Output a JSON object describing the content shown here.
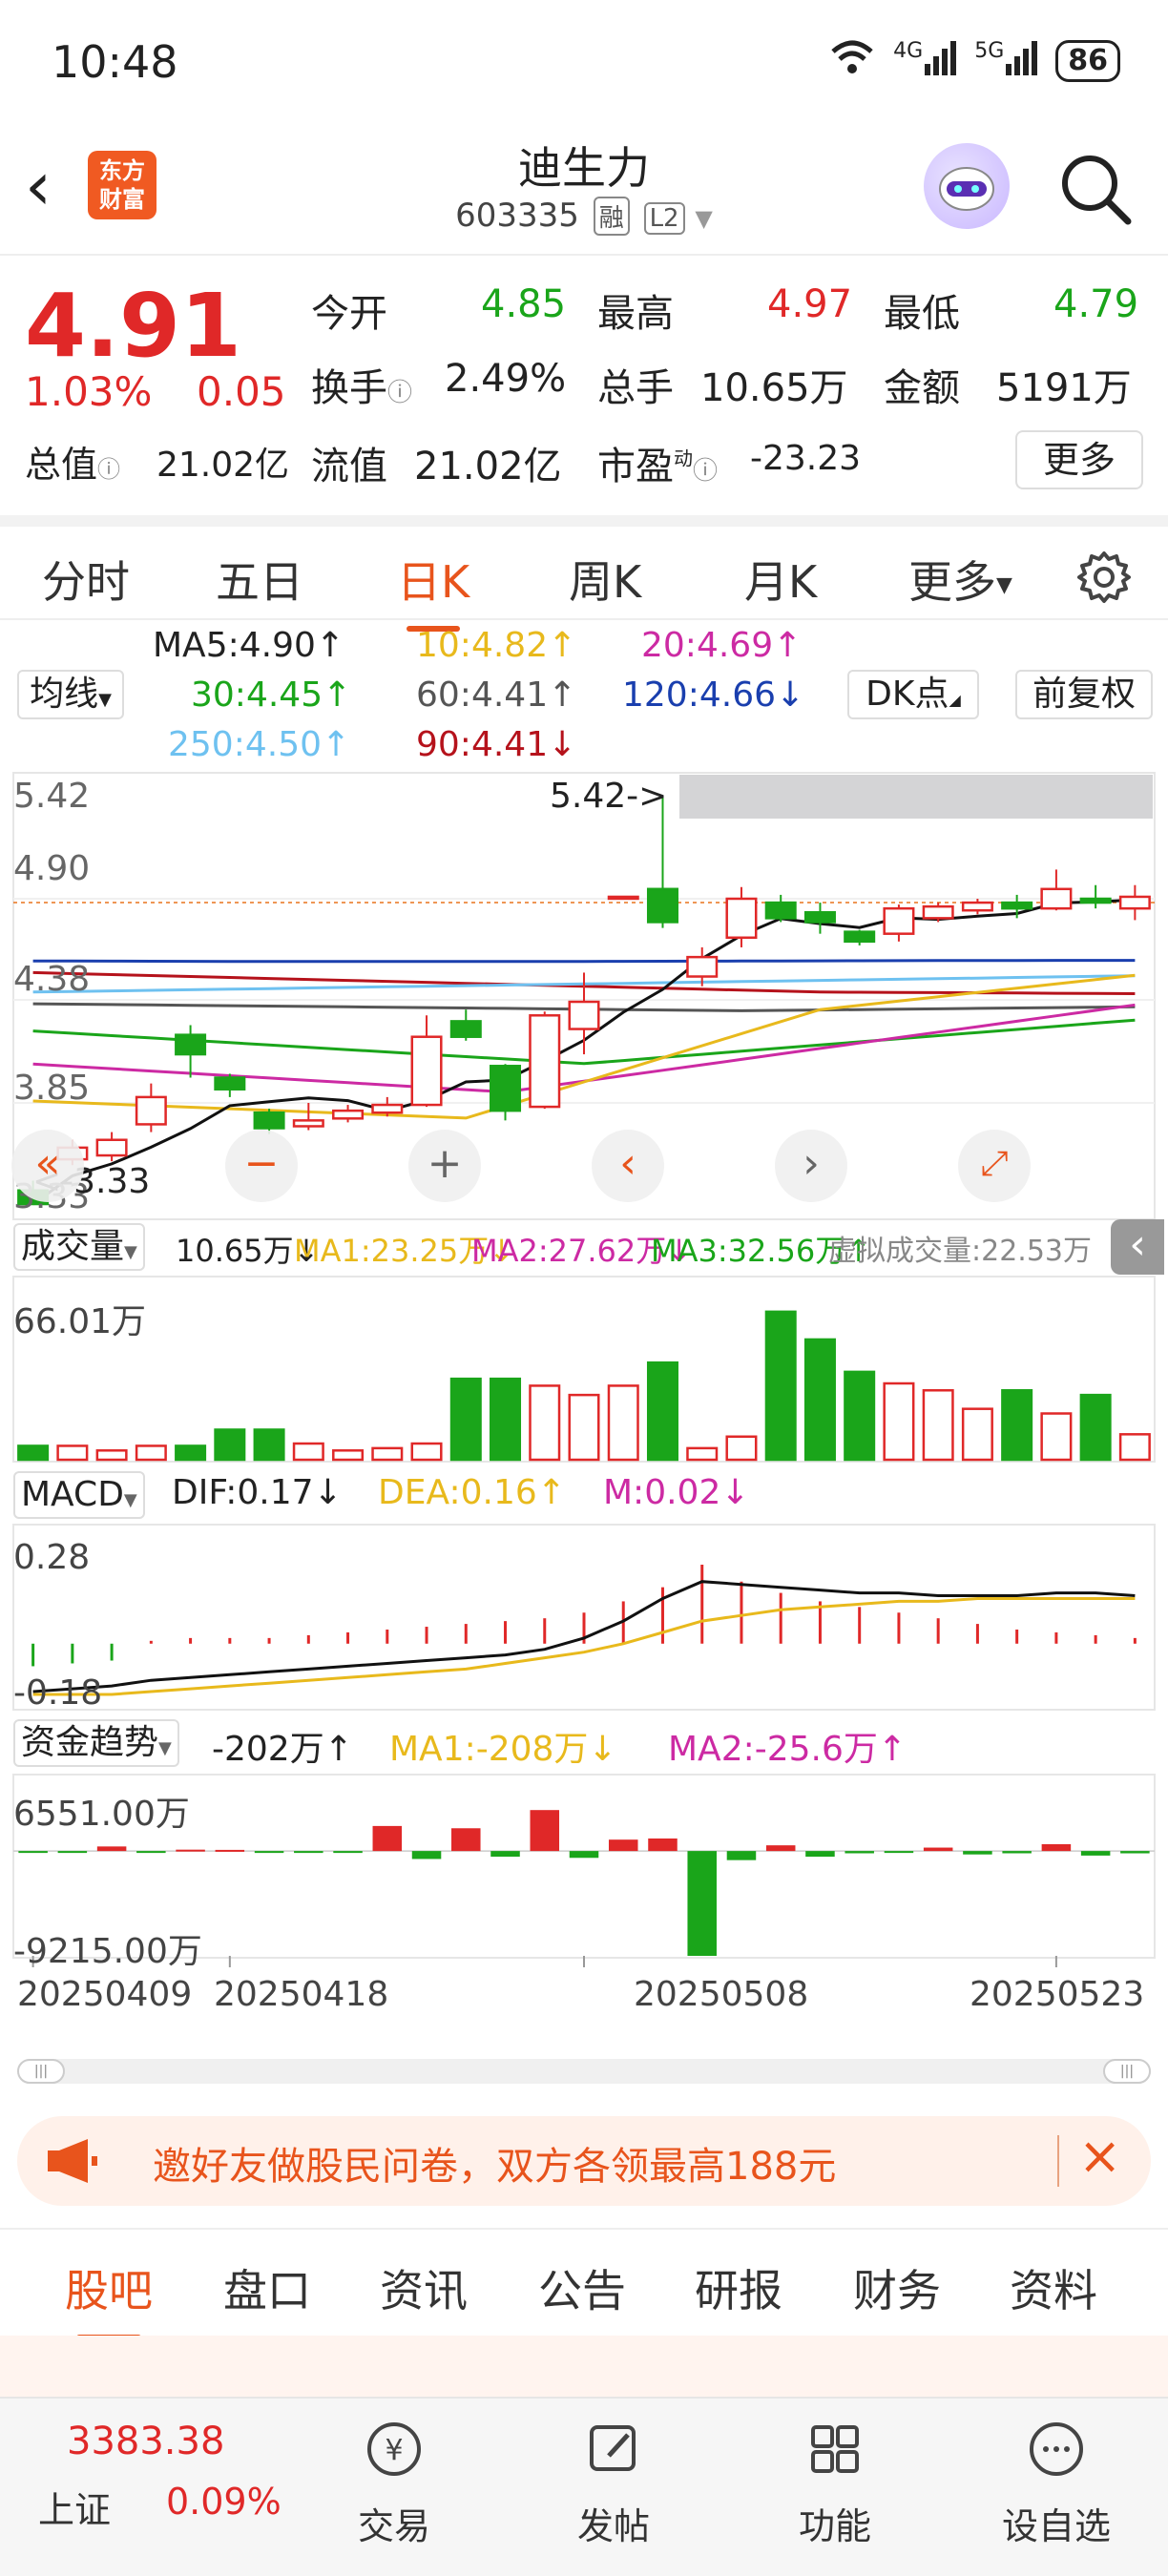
{
  "status": {
    "time": "10:48",
    "net1": "4G",
    "net2": "5G",
    "battery": "86"
  },
  "header": {
    "title": "迪生力",
    "code": "603335",
    "tag1": "融",
    "tag2": "L2",
    "logo_line1": "东方",
    "logo_line2": "财富"
  },
  "quote": {
    "price": "4.91",
    "pct": "1.03%",
    "change": "0.05",
    "open_label": "今开",
    "open": "4.85",
    "high_label": "最高",
    "high": "4.97",
    "low_label": "最低",
    "low": "4.79",
    "turnover_label": "换手",
    "turnover": "2.49%",
    "volume_label": "总手",
    "volume": "10.65万",
    "amount_label": "金额",
    "amount": "5191万",
    "mcap_label": "总值",
    "mcap": "21.02亿",
    "float_label": "流值",
    "float": "21.02亿",
    "pe_label": "市盈",
    "pe_sup": "动",
    "pe": "-23.23",
    "more": "更多"
  },
  "tabs": [
    "分时",
    "五日",
    "日K",
    "周K",
    "月K",
    "更多"
  ],
  "ma": {
    "selector": "均线",
    "ma5": "MA5:4.90↑",
    "ma10": "10:4.82↑",
    "ma20": "20:4.69↑",
    "ma30": "30:4.45↑",
    "ma60": "60:4.41↑",
    "ma120": "120:4.66↓",
    "ma250": "250:4.50↑",
    "ma90": "90:4.41↓",
    "dk": "DK点",
    "adj": "前复权"
  },
  "kline": {
    "y_top": "5.42",
    "y_490": "4.90",
    "y_438": "4.38",
    "y_385": "3.85",
    "y_bottom": "3.33",
    "high_mark": "5.42->",
    "low_mark": "<-3.33"
  },
  "volume": {
    "selector": "成交量",
    "val": "10.65万↓",
    "ma1": "MA1:23.25万↓",
    "ma2": "MA2:27.62万↓",
    "ma3": "MA3:32.56万↑",
    "virtual": "虚拟成交量:22.53万",
    "ymax": "66.01万"
  },
  "macd": {
    "selector": "MACD",
    "dif": "DIF:0.17↓",
    "dea": "DEA:0.16↑",
    "m": "M:0.02↓",
    "ytop": "0.28",
    "ybottom": "-0.18"
  },
  "fund": {
    "selector": "资金趋势",
    "val": "-202万↑",
    "ma1": "MA1:-208万↓",
    "ma2": "MA2:-25.6万↑",
    "ytop": "6551.00万",
    "ybottom": "-9215.00万"
  },
  "dates": [
    "20250409",
    "20250418",
    "20250508",
    "20250523"
  ],
  "promo": {
    "text": "邀好友做股民问卷，双方各领最高188元"
  },
  "bottom_tabs": [
    "股吧",
    "盘口",
    "资讯",
    "公告",
    "研报",
    "财务",
    "资料"
  ],
  "footer": {
    "index_value": "3383.38",
    "index_name": "上证",
    "index_pct": "0.09%",
    "trade": "交易",
    "post": "发帖",
    "func": "功能",
    "watch": "设自选"
  },
  "colors": {
    "up": "#e02828",
    "down": "#1aa51a",
    "accent": "#e8541c"
  },
  "chart_data": {
    "type": "candlestick",
    "candles": [
      {
        "o": 3.4,
        "c": 3.33,
        "h": 3.45,
        "l": 3.33
      },
      {
        "o": 3.56,
        "c": 3.62,
        "h": 3.66,
        "l": 3.53
      },
      {
        "o": 3.58,
        "c": 3.66,
        "h": 3.7,
        "l": 3.55
      },
      {
        "o": 3.74,
        "c": 3.88,
        "h": 3.95,
        "l": 3.7
      },
      {
        "o": 4.2,
        "c": 4.1,
        "h": 4.25,
        "l": 3.98
      },
      {
        "o": 3.98,
        "c": 3.92,
        "h": 4.0,
        "l": 3.88
      },
      {
        "o": 3.8,
        "c": 3.72,
        "h": 3.82,
        "l": 3.69
      },
      {
        "o": 3.73,
        "c": 3.76,
        "h": 3.85,
        "l": 3.71
      },
      {
        "o": 3.77,
        "c": 3.81,
        "h": 3.84,
        "l": 3.75
      },
      {
        "o": 3.8,
        "c": 3.84,
        "h": 3.88,
        "l": 3.78
      },
      {
        "o": 3.84,
        "c": 4.19,
        "h": 4.3,
        "l": 3.83
      },
      {
        "o": 4.27,
        "c": 4.19,
        "h": 4.33,
        "l": 4.17
      },
      {
        "o": 4.04,
        "c": 3.81,
        "h": 4.05,
        "l": 3.76
      },
      {
        "o": 3.83,
        "c": 4.3,
        "h": 4.32,
        "l": 3.82
      },
      {
        "o": 4.23,
        "c": 4.37,
        "h": 4.52,
        "l": 4.1
      },
      {
        "o": 4.91,
        "c": 4.91,
        "h": 4.91,
        "l": 4.91
      },
      {
        "o": 4.95,
        "c": 4.78,
        "h": 5.42,
        "l": 4.75
      },
      {
        "o": 4.5,
        "c": 4.6,
        "h": 4.65,
        "l": 4.45
      },
      {
        "o": 4.7,
        "c": 4.9,
        "h": 4.96,
        "l": 4.65
      },
      {
        "o": 4.88,
        "c": 4.8,
        "h": 4.92,
        "l": 4.78
      },
      {
        "o": 4.83,
        "c": 4.78,
        "h": 4.88,
        "l": 4.72
      },
      {
        "o": 4.73,
        "c": 4.68,
        "h": 4.74,
        "l": 4.66
      },
      {
        "o": 4.72,
        "c": 4.85,
        "h": 4.87,
        "l": 4.68
      },
      {
        "o": 4.8,
        "c": 4.86,
        "h": 4.88,
        "l": 4.78
      },
      {
        "o": 4.84,
        "c": 4.88,
        "h": 4.9,
        "l": 4.82
      },
      {
        "o": 4.88,
        "c": 4.85,
        "h": 4.92,
        "l": 4.8
      },
      {
        "o": 4.85,
        "c": 4.95,
        "h": 5.05,
        "l": 4.84
      },
      {
        "o": 4.9,
        "c": 4.88,
        "h": 4.97,
        "l": 4.85
      },
      {
        "o": 4.85,
        "c": 4.91,
        "h": 4.97,
        "l": 4.79
      }
    ],
    "volume": [
      6,
      6,
      4,
      6,
      6,
      13,
      13,
      7,
      4,
      5,
      7,
      35,
      35,
      32,
      28,
      32,
      42,
      5,
      10,
      64,
      52,
      38,
      33,
      30,
      22,
      30,
      20,
      28,
      11
    ],
    "macd_dif": [
      -0.17,
      -0.16,
      -0.15,
      -0.13,
      -0.12,
      -0.11,
      -0.1,
      -0.09,
      -0.08,
      -0.07,
      -0.06,
      -0.05,
      -0.04,
      -0.02,
      0.02,
      0.08,
      0.16,
      0.22,
      0.21,
      0.2,
      0.19,
      0.18,
      0.18,
      0.17,
      0.17,
      0.17,
      0.18,
      0.18,
      0.17
    ],
    "macd_dea": [
      -0.18,
      -0.18,
      -0.18,
      -0.17,
      -0.16,
      -0.15,
      -0.14,
      -0.13,
      -0.12,
      -0.11,
      -0.1,
      -0.09,
      -0.07,
      -0.05,
      -0.03,
      0.0,
      0.04,
      0.08,
      0.1,
      0.12,
      0.13,
      0.14,
      0.15,
      0.15,
      0.16,
      0.16,
      0.16,
      0.16,
      0.16
    ],
    "macd_m": [
      -0.08,
      -0.07,
      -0.06,
      0.01,
      0.02,
      0.02,
      0.02,
      0.03,
      0.04,
      0.05,
      0.06,
      0.07,
      0.08,
      0.09,
      0.11,
      0.15,
      0.2,
      0.28,
      0.22,
      0.18,
      0.15,
      0.13,
      0.11,
      0.09,
      0.07,
      0.05,
      0.04,
      0.03,
      0.02
    ],
    "fund": [
      -100,
      -150,
      400,
      -80,
      120,
      100,
      -60,
      -40,
      -20,
      2200,
      -700,
      2000,
      -500,
      3600,
      -600,
      1000,
      1100,
      -9215,
      -800,
      500,
      -500,
      -200,
      -100,
      300,
      -300,
      -200,
      600,
      -400,
      -202
    ],
    "y_min": 3.33,
    "y_max": 5.42
  }
}
